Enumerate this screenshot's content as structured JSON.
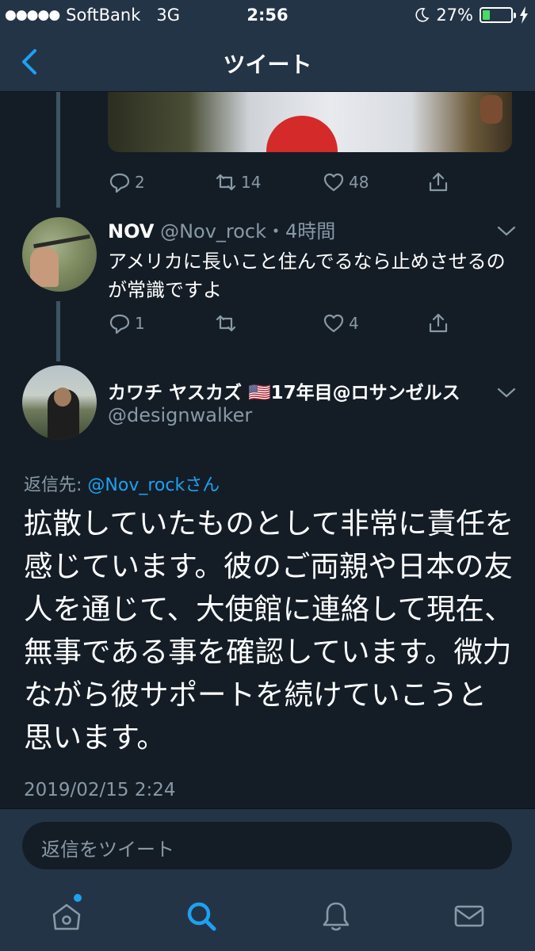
{
  "status_bar": {
    "signal": "●●●●●",
    "carrier": "SoftBank",
    "network": "3G",
    "time": "2:56",
    "battery_percent": "27%",
    "battery_level": 0.27
  },
  "nav": {
    "title": "ツイート",
    "back_icon": "chevron-left-icon"
  },
  "parent_tweet_actions": {
    "reply_count": "2",
    "retweet_count": "14",
    "like_count": "48"
  },
  "reply_tweet": {
    "name": "NOV",
    "handle_time": "@Nov_rock・4時間",
    "text": "アメリカに長いこと住んでるなら止めさせるのが常識ですよ",
    "reply_count": "1",
    "retweet_count": "",
    "like_count": "4"
  },
  "main_tweet": {
    "name": "カワチ ヤスカズ 🇺🇸17年目@ロサンゼルス",
    "handle": "@designwalker",
    "replying_prefix": "返信先: ",
    "replying_mention": "@Nov_rockさん",
    "text": "拡散していたものとして非常に責任を感じています。彼のご両親や日本の友人を通じて、大使館に連絡して現在、無事である事を確認しています。微力ながら彼サポートを続けていこうと思います。",
    "timestamp": "2019/02/15 2:24"
  },
  "reply_bar": {
    "placeholder": "返信をツイート"
  },
  "tab_bar": {
    "items": [
      "home-icon",
      "search-icon",
      "notifications-icon",
      "messages-icon"
    ],
    "active": "search-icon"
  },
  "colors": {
    "background": "#141d26",
    "bar": "#243447",
    "accent": "#1da1f2",
    "secondary_text": "#8899a6"
  }
}
